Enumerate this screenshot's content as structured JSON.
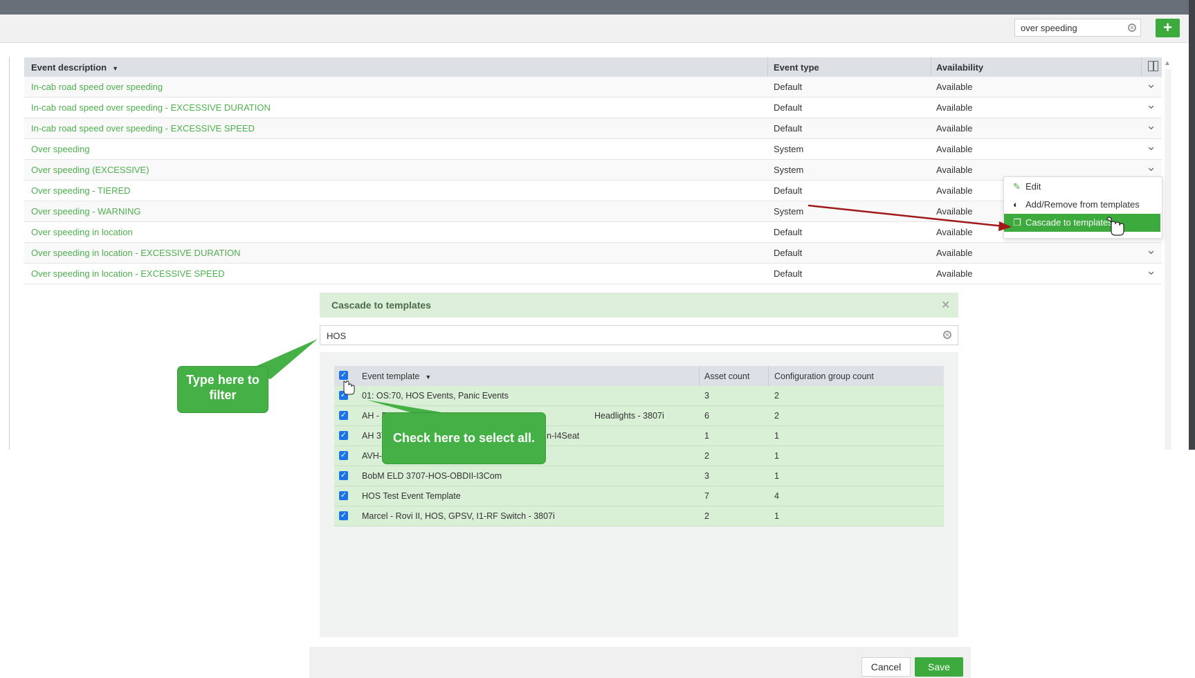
{
  "toolbar": {
    "search_value": "over speeding",
    "add_icon": "plus-icon"
  },
  "grid": {
    "columns": [
      "Event description",
      "Event type",
      "Availability"
    ],
    "rows": [
      {
        "description": "In-cab road speed over speeding",
        "type": "Default",
        "availability": "Available"
      },
      {
        "description": "In-cab road speed over speeding - EXCESSIVE DURATION",
        "type": "Default",
        "availability": "Available"
      },
      {
        "description": "In-cab road speed over speeding - EXCESSIVE SPEED",
        "type": "Default",
        "availability": "Available"
      },
      {
        "description": "Over speeding",
        "type": "System",
        "availability": "Available"
      },
      {
        "description": "Over speeding (EXCESSIVE)",
        "type": "System",
        "availability": "Available"
      },
      {
        "description": "Over speeding - TIERED",
        "type": "Default",
        "availability": "Available"
      },
      {
        "description": "Over speeding - WARNING",
        "type": "System",
        "availability": "Available"
      },
      {
        "description": "Over speeding in location",
        "type": "Default",
        "availability": "Available"
      },
      {
        "description": "Over speeding in location - EXCESSIVE DURATION",
        "type": "Default",
        "availability": "Available"
      },
      {
        "description": "Over speeding in location - EXCESSIVE SPEED",
        "type": "Default",
        "availability": "Available"
      }
    ]
  },
  "context_menu": {
    "items": [
      {
        "label": "Edit",
        "icon": "edit-icon"
      },
      {
        "label": "Add/Remove from templates",
        "icon": "toggle-icon"
      },
      {
        "label": "Cascade to templates",
        "icon": "copy-icon"
      }
    ]
  },
  "modal": {
    "title": "Cascade to templates",
    "filter_value": "HOS",
    "columns": [
      "Event template",
      "Asset count",
      "Configuration group count"
    ],
    "rows": [
      {
        "template": "01: OS:70, HOS Events, Panic Events",
        "assets": "3",
        "groups": "2"
      },
      {
        "template": "AH - E",
        "template_tail": "Headlights - 3807i",
        "assets": "6",
        "groups": "2"
      },
      {
        "template": "AH 37",
        "template_tail": "n-I4Seat",
        "assets": "1",
        "groups": "1"
      },
      {
        "template": "AVH-H",
        "assets": "2",
        "groups": "1"
      },
      {
        "template": "BobM ELD 3707-HOS-OBDII-I3Com",
        "assets": "3",
        "groups": "1"
      },
      {
        "template": "HOS Test Event Template",
        "assets": "7",
        "groups": "4"
      },
      {
        "template": "Marcel - Rovi II, HOS, GPSV, I1-RF Switch - 3807i",
        "assets": "2",
        "groups": "1"
      }
    ],
    "cancel_label": "Cancel",
    "save_label": "Save"
  },
  "callouts": {
    "filter": "Type here to filter",
    "select_all": "Check here to select all."
  },
  "colors": {
    "accent": "#3caa3c",
    "link": "#4eb04e",
    "annotation_arrow": "#a01818"
  }
}
